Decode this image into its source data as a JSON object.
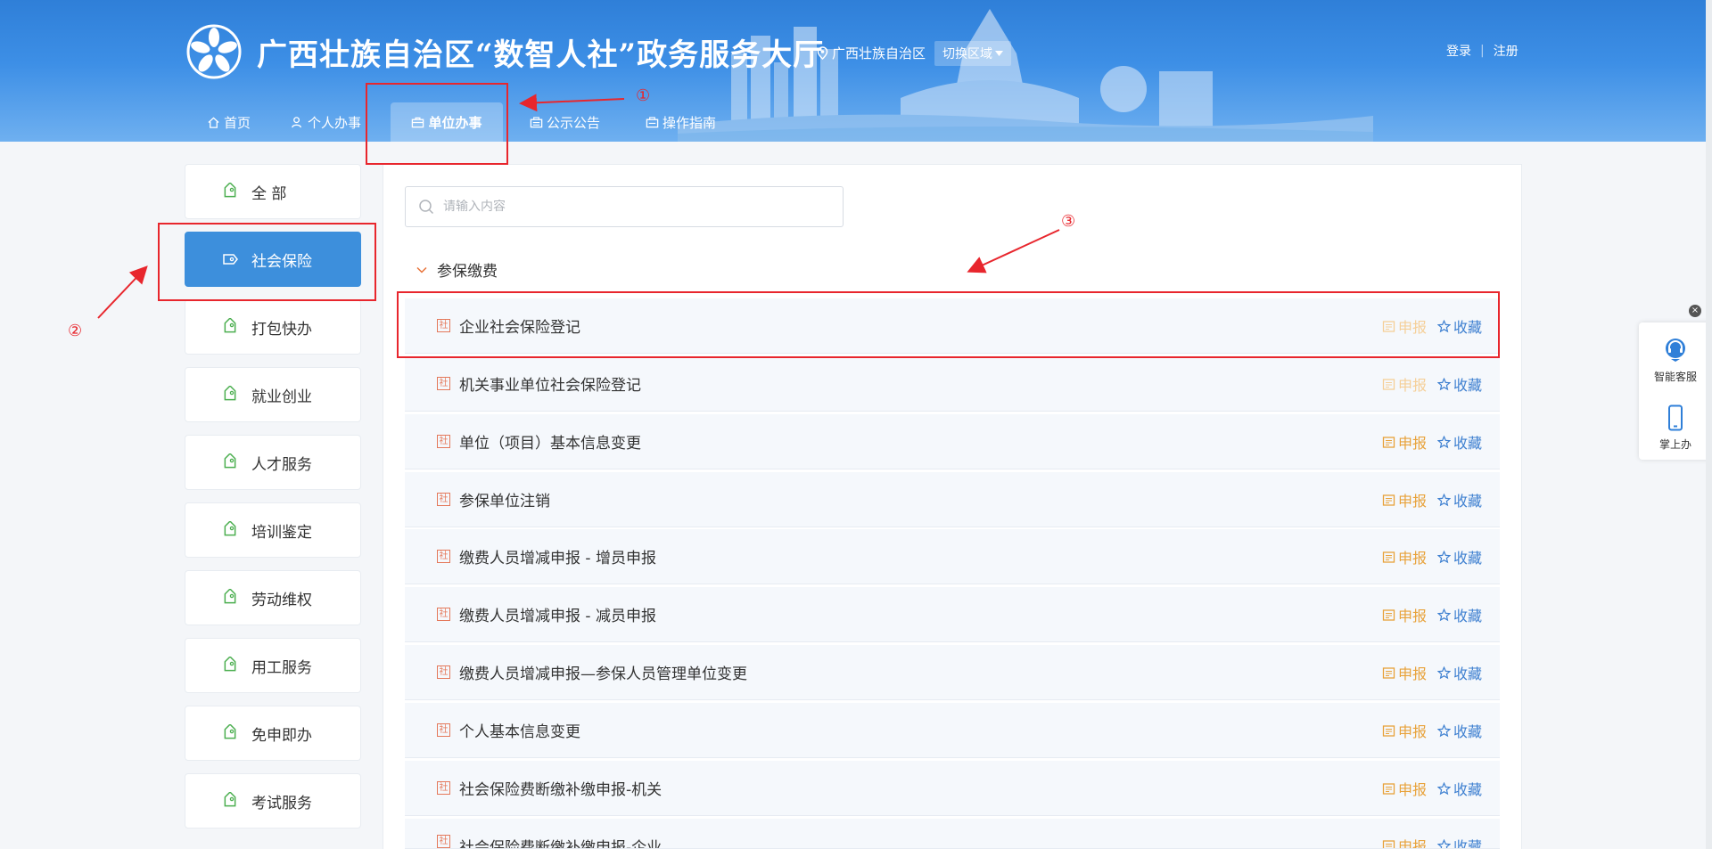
{
  "header": {
    "title": "广西壮族自治区“数智人社”政务服务大厅",
    "region": "广西壮族自治区",
    "region_switch": "切换区域",
    "login": "登录",
    "register": "注册",
    "auth_separator": "|"
  },
  "nav": {
    "home": "首页",
    "personal": "个人办事",
    "unit": "单位办事",
    "notice": "公示公告",
    "guide": "操作指南"
  },
  "sidebar": {
    "items": [
      {
        "label": "全 部",
        "active": false
      },
      {
        "label": "社会保险",
        "active": true
      },
      {
        "label": "打包快办",
        "active": false
      },
      {
        "label": "就业创业",
        "active": false
      },
      {
        "label": "人才服务",
        "active": false
      },
      {
        "label": "培训鉴定",
        "active": false
      },
      {
        "label": "劳动维权",
        "active": false
      },
      {
        "label": "用工服务",
        "active": false
      },
      {
        "label": "免申即办",
        "active": false
      },
      {
        "label": "考试服务",
        "active": false
      }
    ]
  },
  "search": {
    "placeholder": "请输入内容"
  },
  "section": {
    "title": "参保缴费"
  },
  "services": [
    {
      "icon_char": "社",
      "name": "企业社会保险登记",
      "apply": "申报",
      "favorite": "收藏",
      "apply_disabled": true
    },
    {
      "icon_char": "社",
      "name": "机关事业单位社会保险登记",
      "apply": "申报",
      "favorite": "收藏",
      "apply_disabled": true
    },
    {
      "icon_char": "社",
      "name": "单位（项目）基本信息变更",
      "apply": "申报",
      "favorite": "收藏",
      "apply_disabled": false
    },
    {
      "icon_char": "社",
      "name": "参保单位注销",
      "apply": "申报",
      "favorite": "收藏",
      "apply_disabled": false
    },
    {
      "icon_char": "社",
      "name": "缴费人员增减申报 - 增员申报",
      "apply": "申报",
      "favorite": "收藏",
      "apply_disabled": false
    },
    {
      "icon_char": "社",
      "name": "缴费人员增减申报 - 减员申报",
      "apply": "申报",
      "favorite": "收藏",
      "apply_disabled": false
    },
    {
      "icon_char": "社",
      "name": "缴费人员增减申报—参保人员管理单位变更",
      "apply": "申报",
      "favorite": "收藏",
      "apply_disabled": false
    },
    {
      "icon_char": "社",
      "name": "个人基本信息变更",
      "apply": "申报",
      "favorite": "收藏",
      "apply_disabled": false
    },
    {
      "icon_char": "社",
      "name": "社会保险费断缴补缴申报-机关",
      "apply": "申报",
      "favorite": "收藏",
      "apply_disabled": false
    },
    {
      "icon_char": "社",
      "name": "社会保险费断缴补缴申报-企业",
      "apply": "申报",
      "favorite": "收藏",
      "apply_disabled": false
    }
  ],
  "annotations": {
    "one": "①",
    "two": "②",
    "three": "③"
  },
  "float_widget": {
    "close": "×",
    "service": "智能客服",
    "mobile": "掌上办"
  },
  "colors": {
    "header_blue": "#2f7fd8",
    "active_blue": "#3d8fdc",
    "apply_orange": "#e8a23a",
    "favorite_blue": "#3d7fd0",
    "annotation_red": "#e8262d",
    "tag_green": "#4caf50"
  }
}
